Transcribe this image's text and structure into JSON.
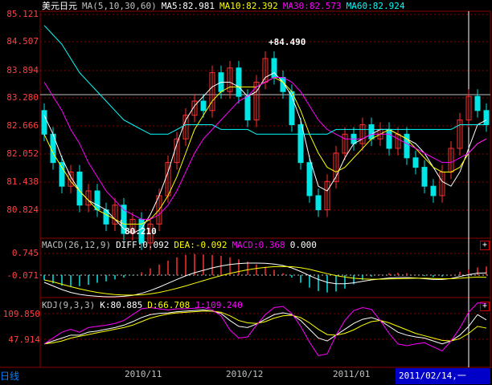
{
  "price_panel": {
    "symbol": "美元日元",
    "ma_param": "MA(5,10,30,60)",
    "ma5": "MA5:82.981",
    "ma10": "MA10:82.392",
    "ma30": "MA30:82.573",
    "ma60": "MA60:82.924",
    "y_ticks": [
      "85.121",
      "84.507",
      "83.894",
      "83.280",
      "82.666",
      "82.052",
      "81.438",
      "80.824"
    ],
    "high_label": "84.490",
    "low_label": "80.210"
  },
  "macd_panel": {
    "param": "MACD(26,12,9)",
    "diff": "DIFF:0.092",
    "dea": "DEA:-0.092",
    "macd": "MACD:0.368",
    "zero": "0.000",
    "y_ticks": [
      "0.745",
      "-0.071"
    ]
  },
  "kdj_panel": {
    "param": "KDJ(9,3,3)",
    "k": "K:80.885",
    "d": "D:66.708",
    "j": "J:109.240",
    "y_ticks": [
      "109.850",
      "47.914"
    ]
  },
  "x_axis": {
    "labels": [
      "2010/11",
      "2010/12",
      "2011/01"
    ]
  },
  "status": {
    "period": "日线",
    "cursor_date": "2011/02/14,一"
  },
  "add_button": "+",
  "colors": {
    "bg": "#000000",
    "grid": "#8b0000",
    "up": "#ff3030",
    "down": "#00e5e5",
    "ma5": "#ffffff",
    "ma10": "#ffff00",
    "ma30": "#ff00ff",
    "ma60": "#00ffff"
  },
  "chart_data": {
    "type": "candlestick",
    "ylim": [
      80.5,
      85.3
    ],
    "series": [
      {
        "name": "MA5",
        "values": [
          83.1,
          82.7,
          82.2,
          81.8,
          81.5,
          81.3,
          81.2,
          81.1,
          80.9,
          80.7,
          80.6,
          80.7,
          81.0,
          81.4,
          81.9,
          82.5,
          83.0,
          83.3,
          83.5,
          83.7,
          83.8,
          83.8,
          83.7,
          83.5,
          83.6,
          83.9,
          84.0,
          83.8,
          83.5,
          83.0,
          82.2,
          81.6,
          81.5,
          81.8,
          82.2,
          82.5,
          82.6,
          82.7,
          82.8,
          82.8,
          82.7,
          82.6,
          82.5,
          82.3,
          82.0,
          81.7,
          81.6,
          81.9,
          82.4,
          82.9,
          83.0
        ]
      },
      {
        "name": "MA10",
        "values": [
          82.7,
          82.3,
          82.0,
          81.7,
          81.5,
          81.3,
          81.1,
          81.0,
          80.9,
          80.8,
          80.8,
          80.8,
          80.9,
          81.1,
          81.4,
          81.8,
          82.3,
          82.8,
          83.1,
          83.4,
          83.6,
          83.7,
          83.7,
          83.7,
          83.7,
          83.8,
          83.9,
          83.8,
          83.6,
          83.2,
          82.7,
          82.3,
          82.0,
          81.9,
          82.0,
          82.2,
          82.4,
          82.6,
          82.7,
          82.8,
          82.7,
          82.6,
          82.4,
          82.2,
          82.0,
          81.9,
          81.9,
          82.0,
          82.3,
          82.5,
          82.6
        ]
      },
      {
        "name": "MA30",
        "values": [
          83.8,
          83.5,
          83.2,
          82.8,
          82.5,
          82.1,
          81.8,
          81.5,
          81.3,
          81.1,
          81.0,
          80.9,
          80.9,
          81.0,
          81.2,
          81.5,
          81.9,
          82.3,
          82.6,
          82.8,
          83.0,
          83.2,
          83.4,
          83.5,
          83.7,
          83.8,
          83.9,
          83.9,
          83.8,
          83.6,
          83.3,
          83.0,
          82.8,
          82.7,
          82.6,
          82.6,
          82.6,
          82.7,
          82.7,
          82.7,
          82.6,
          82.5,
          82.4,
          82.3,
          82.2,
          82.1,
          82.1,
          82.2,
          82.3,
          82.5,
          82.6
        ]
      },
      {
        "name": "MA60",
        "values": [
          85.0,
          84.8,
          84.6,
          84.3,
          84.0,
          83.8,
          83.6,
          83.4,
          83.2,
          83.0,
          82.9,
          82.8,
          82.7,
          82.7,
          82.7,
          82.8,
          82.9,
          82.9,
          82.9,
          82.9,
          82.8,
          82.8,
          82.8,
          82.8,
          82.7,
          82.7,
          82.7,
          82.7,
          82.7,
          82.7,
          82.7,
          82.7,
          82.7,
          82.8,
          82.8,
          82.8,
          82.8,
          82.8,
          82.8,
          82.8,
          82.8,
          82.8,
          82.8,
          82.8,
          82.8,
          82.8,
          82.8,
          82.9,
          82.9,
          82.9,
          82.9
        ]
      }
    ],
    "candles": [
      [
        83.2,
        82.7
      ],
      [
        82.7,
        82.1
      ],
      [
        82.1,
        81.6
      ],
      [
        81.6,
        81.9
      ],
      [
        81.9,
        81.2
      ],
      [
        81.2,
        81.5
      ],
      [
        81.5,
        81.1
      ],
      [
        81.1,
        80.8
      ],
      [
        80.8,
        81.2
      ],
      [
        81.2,
        80.6
      ],
      [
        80.6,
        80.9
      ],
      [
        80.9,
        80.4
      ],
      [
        80.4,
        80.8
      ],
      [
        80.8,
        81.4
      ],
      [
        81.4,
        82.1
      ],
      [
        82.1,
        82.6
      ],
      [
        82.6,
        83.1
      ],
      [
        83.1,
        83.4
      ],
      [
        83.4,
        83.2
      ],
      [
        83.2,
        84.0
      ],
      [
        84.0,
        83.6
      ],
      [
        83.6,
        84.1
      ],
      [
        84.1,
        83.5
      ],
      [
        83.5,
        83.0
      ],
      [
        83.0,
        83.8
      ],
      [
        83.8,
        84.3
      ],
      [
        84.3,
        83.9
      ],
      [
        83.9,
        83.6
      ],
      [
        83.6,
        82.9
      ],
      [
        82.9,
        82.1
      ],
      [
        82.1,
        81.4
      ],
      [
        81.4,
        81.1
      ],
      [
        81.1,
        81.7
      ],
      [
        81.7,
        82.3
      ],
      [
        82.3,
        82.7
      ],
      [
        82.7,
        82.5
      ],
      [
        82.5,
        82.9
      ],
      [
        82.9,
        82.6
      ],
      [
        82.6,
        82.8
      ],
      [
        82.8,
        82.4
      ],
      [
        82.4,
        82.7
      ],
      [
        82.7,
        82.2
      ],
      [
        82.2,
        82.0
      ],
      [
        82.0,
        81.6
      ],
      [
        81.6,
        81.4
      ],
      [
        81.4,
        81.9
      ],
      [
        81.9,
        82.4
      ],
      [
        82.4,
        83.0
      ],
      [
        83.0,
        83.5
      ],
      [
        83.5,
        83.2
      ],
      [
        83.2,
        82.9
      ]
    ],
    "macd": {
      "diff": [
        -0.3,
        -0.45,
        -0.6,
        -0.72,
        -0.8,
        -0.85,
        -0.88,
        -0.9,
        -0.9,
        -0.88,
        -0.84,
        -0.76,
        -0.64,
        -0.5,
        -0.34,
        -0.18,
        -0.03,
        0.1,
        0.2,
        0.3,
        0.38,
        0.44,
        0.48,
        0.5,
        0.5,
        0.49,
        0.46,
        0.4,
        0.3,
        0.15,
        -0.02,
        -0.18,
        -0.3,
        -0.36,
        -0.36,
        -0.32,
        -0.26,
        -0.2,
        -0.16,
        -0.12,
        -0.1,
        -0.1,
        -0.12,
        -0.15,
        -0.18,
        -0.18,
        -0.14,
        -0.06,
        0.02,
        0.08,
        0.09
      ],
      "dea": [
        -0.2,
        -0.28,
        -0.38,
        -0.48,
        -0.57,
        -0.65,
        -0.72,
        -0.77,
        -0.81,
        -0.83,
        -0.83,
        -0.82,
        -0.78,
        -0.72,
        -0.64,
        -0.55,
        -0.45,
        -0.34,
        -0.23,
        -0.12,
        -0.02,
        0.07,
        0.15,
        0.22,
        0.28,
        0.32,
        0.35,
        0.36,
        0.35,
        0.31,
        0.24,
        0.15,
        0.06,
        -0.02,
        -0.08,
        -0.13,
        -0.16,
        -0.17,
        -0.17,
        -0.16,
        -0.15,
        -0.14,
        -0.13,
        -0.13,
        -0.14,
        -0.15,
        -0.15,
        -0.13,
        -0.1,
        -0.08,
        -0.09
      ]
    },
    "kdj": {
      "k": [
        40,
        45,
        50,
        55,
        55,
        60,
        62,
        65,
        68,
        72,
        78,
        85,
        90,
        92,
        93,
        95,
        96,
        97,
        98,
        96,
        92,
        80,
        70,
        68,
        74,
        82,
        90,
        93,
        90,
        80,
        65,
        50,
        45,
        55,
        65,
        75,
        82,
        85,
        80,
        70,
        60,
        55,
        52,
        50,
        45,
        40,
        45,
        55,
        70,
        90,
        81
      ],
      "d": [
        40,
        42,
        45,
        50,
        53,
        56,
        59,
        62,
        65,
        68,
        72,
        78,
        84,
        88,
        91,
        93,
        94,
        95,
        96,
        96,
        94,
        88,
        80,
        76,
        75,
        78,
        84,
        88,
        89,
        85,
        76,
        65,
        56,
        55,
        58,
        64,
        72,
        78,
        80,
        76,
        70,
        64,
        58,
        54,
        50,
        46,
        45,
        49,
        58,
        70,
        67
      ],
      "j": [
        40,
        50,
        60,
        65,
        60,
        68,
        70,
        72,
        75,
        80,
        90,
        100,
        102,
        100,
        98,
        100,
        100,
        101,
        102,
        98,
        88,
        64,
        50,
        52,
        72,
        90,
        102,
        104,
        92,
        70,
        43,
        20,
        23,
        55,
        80,
        97,
        102,
        99,
        80,
        58,
        40,
        37,
        40,
        42,
        35,
        28,
        45,
        67,
        94,
        110,
        109
      ]
    }
  }
}
